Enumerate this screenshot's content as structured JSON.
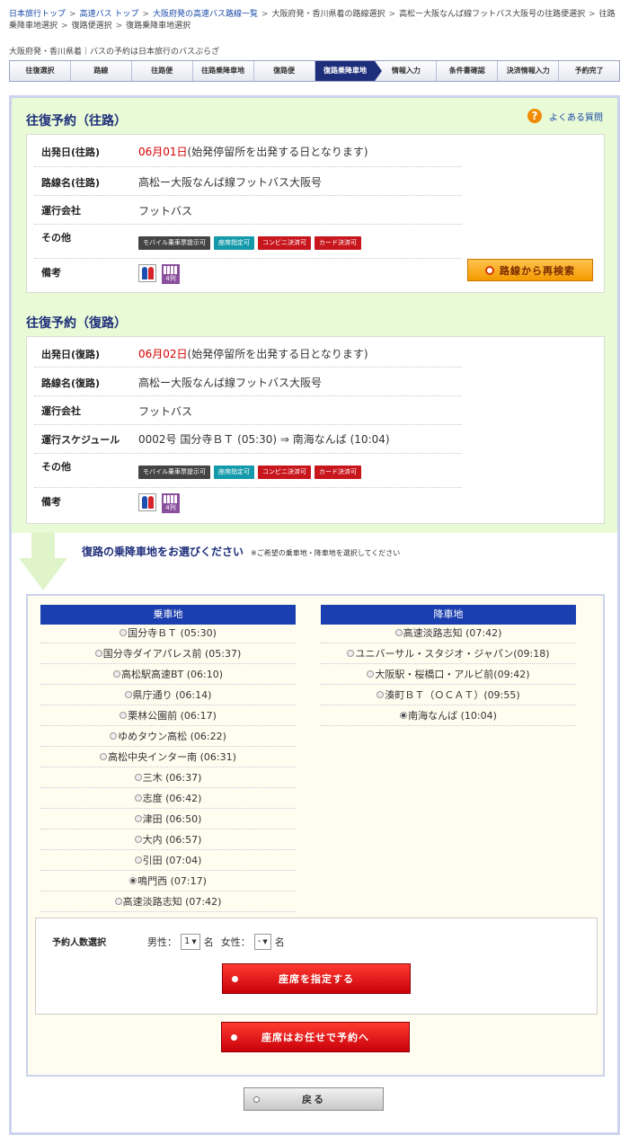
{
  "breadcrumb": [
    {
      "label": "日本旅行トップ",
      "link": true
    },
    {
      "label": "高速バス トップ",
      "link": true
    },
    {
      "label": "大阪府発の高速バス路線一覧",
      "link": true
    },
    {
      "label": "大阪府発・香川県着の路線選択",
      "link": false
    },
    {
      "label": "高松ー大阪なんば線フットバス大阪号の往路便選択",
      "link": false
    },
    {
      "label": "往路乗降車地選択",
      "link": false
    },
    {
      "label": "復路便選択",
      "link": false
    },
    {
      "label": "復路乗降車地選択",
      "link": false
    }
  ],
  "subtitle": "大阪府発・香川県着｜バスの予約は日本旅行のバスぷらざ",
  "steps": [
    "往復選択",
    "路線",
    "往路便",
    "往路乗降車地",
    "復路便",
    "復路乗降車地",
    "情報入力",
    "条件書確認",
    "決済情報入力",
    "予約完了"
  ],
  "outbound": {
    "title": "往復予約（往路）",
    "faq": "よくある質問",
    "date_label": "出発日(往路)",
    "date": "06月01日",
    "date_note": "(始発停留所を出発する日となります)",
    "route_label": "路線名(往路)",
    "route": "高松ー大阪なんば線フットバス大阪号",
    "company_label": "運行会社",
    "company": "フットバス",
    "other_label": "その他",
    "notes_label": "備考",
    "research_button": "路線から再検索"
  },
  "inbound": {
    "title": "往復予約（復路）",
    "date_label": "出発日(復路)",
    "date": "06月02日",
    "date_note": "(始発停留所を出発する日となります)",
    "route_label": "路線名(復路)",
    "route": "高松ー大阪なんば線フットバス大阪号",
    "company_label": "運行会社",
    "company": "フットバス",
    "schedule_label": "運行スケジュール",
    "schedule": "0002号 国分寺ＢＴ (05:30) ⇒ 南海なんば (10:04)",
    "other_label": "その他",
    "notes_label": "備考"
  },
  "badges": [
    "モバイル乗車票提示可",
    "座席指定可",
    "コンビニ決済可",
    "カード決済可"
  ],
  "seat_icon_label": "4列",
  "choose": {
    "title": "復路の乗降車地をお選びください",
    "note": "※ご希望の乗車地・降車地を選択してください"
  },
  "boarding": {
    "header": "乗車地",
    "stops": [
      "国分寺ＢＴ (05:30)",
      "国分寺ダイアパレス前 (05:37)",
      "高松駅高速BT (06:10)",
      "県庁通り (06:14)",
      "栗林公園前 (06:17)",
      "ゆめタウン高松 (06:22)",
      "高松中央インター南 (06:31)",
      "三木 (06:37)",
      "志度 (06:42)",
      "津田 (06:50)",
      "大内 (06:57)",
      "引田 (07:04)",
      "鳴門西 (07:17)",
      "高速淡路志知 (07:42)"
    ],
    "selected": 12
  },
  "alighting": {
    "header": "降車地",
    "stops": [
      "高速淡路志知 (07:42)",
      "ユニバーサル・スタジオ・ジャパン(09:18)",
      "大阪駅・桜橋口・アルビ前(09:42)",
      "湊町ＢＴ（ＯＣＡＴ）(09:55)",
      "南海なんば (10:04)"
    ],
    "selected": 4
  },
  "count": {
    "label": "予約人数選択",
    "male_label": "男性：",
    "male_value": "1",
    "female_label": "女性：",
    "female_value": "-",
    "unit": "名"
  },
  "buttons": {
    "seat_select": "座席を指定する",
    "auto_seat": "座席はお任せで予約へ",
    "back": "戻る"
  }
}
